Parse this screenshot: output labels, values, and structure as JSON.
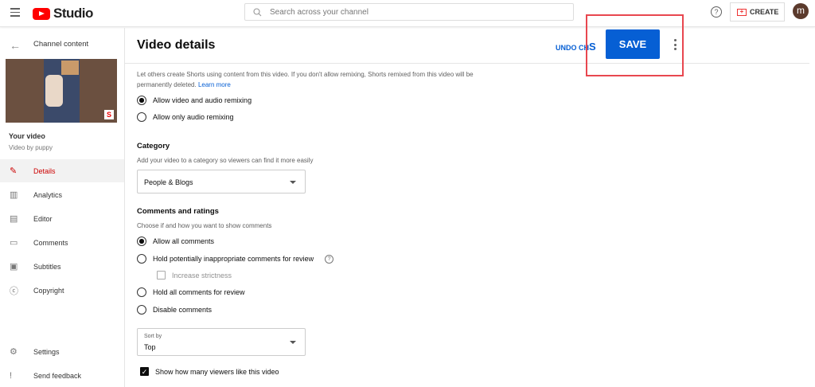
{
  "topbar": {
    "app_name": "Studio",
    "search_placeholder": "Search across your channel",
    "help": "?",
    "create_label": "CREATE",
    "avatar_letter": "m"
  },
  "sidebar": {
    "back_label": "Channel content",
    "your_video": "Your video",
    "video_by": "Video by puppy",
    "items": [
      {
        "label": "Details",
        "icon": "pencil-icon",
        "glyph": "✎"
      },
      {
        "label": "Analytics",
        "icon": "analytics-icon",
        "glyph": "▥"
      },
      {
        "label": "Editor",
        "icon": "editor-icon",
        "glyph": "▤"
      },
      {
        "label": "Comments",
        "icon": "comments-icon",
        "glyph": "▭"
      },
      {
        "label": "Subtitles",
        "icon": "subtitles-icon",
        "glyph": "▣"
      },
      {
        "label": "Copyright",
        "icon": "copyright-icon",
        "glyph": "ⓒ"
      }
    ],
    "bottom": [
      {
        "label": "Settings",
        "glyph": "⚙"
      },
      {
        "label": "Send feedback",
        "glyph": "!"
      }
    ]
  },
  "main": {
    "title": "Video details",
    "undo_label": "UNDO CH",
    "undo_tail": "S",
    "save_label": "SAVE",
    "remix": {
      "description": "Let others create Shorts using content from this video. If you don't allow remixing, Shorts remixed from this video will be",
      "description2": "permanently deleted.",
      "learn_more": "Learn more",
      "options": [
        "Allow video and audio remixing",
        "Allow only audio remixing"
      ],
      "selected": 0
    },
    "category": {
      "heading": "Category",
      "description": "Add your video to a category so viewers can find it more easily",
      "value": "People & Blogs"
    },
    "comments": {
      "heading": "Comments and ratings",
      "description": "Choose if and how you want to show comments",
      "options": [
        "Allow all comments",
        "Hold potentially inappropriate comments for review",
        "Hold all comments for review",
        "Disable comments"
      ],
      "strictness": "Increase strictness",
      "sort_label": "Sort by",
      "sort_value": "Top",
      "show_likes": "Show how many viewers like this video"
    }
  }
}
